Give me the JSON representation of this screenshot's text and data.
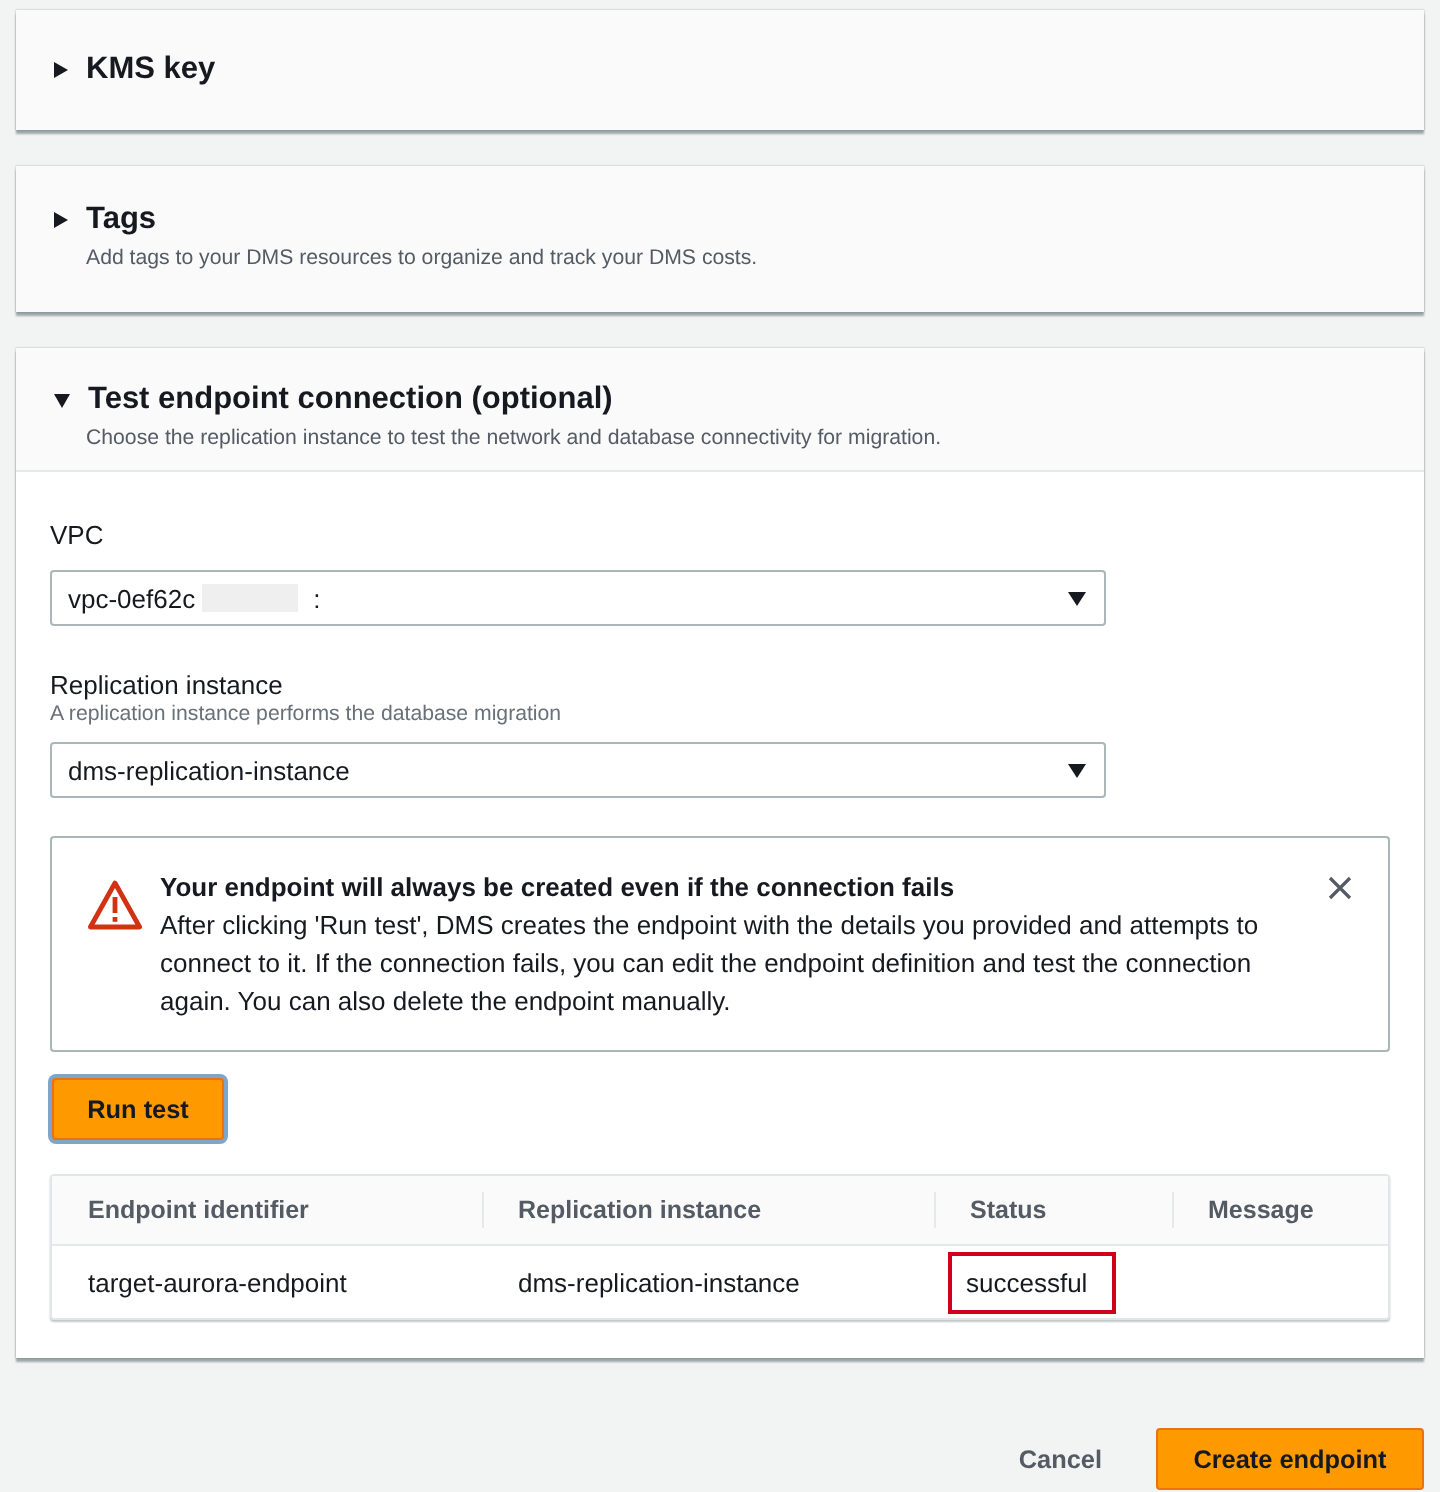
{
  "sections": [
    {
      "title": "KMS key",
      "expanded": false
    },
    {
      "title": "Tags",
      "description": "Add tags to your DMS resources to organize and track your DMS costs.",
      "expanded": false
    },
    {
      "title": "Test endpoint connection (optional)",
      "description": "Choose the replication instance to test the network and database connectivity for migration.",
      "expanded": true,
      "fields": [
        {
          "label": "VPC",
          "value": "vpc-0ef62c",
          "redacted": true,
          "value_suffix": ":"
        },
        {
          "label": "Replication instance",
          "hint": "A replication instance performs the database migration",
          "value": "dms-replication-instance"
        }
      ],
      "alert": {
        "kind": "warning",
        "title": "Your endpoint will always be created even if the connection fails",
        "text": "After clicking 'Run test', DMS creates the endpoint with the details you provided and attempts to connect to it. If the connection fails, you can edit the endpoint definition and test the connection again. You can also delete the endpoint manually.",
        "dismissible": true
      },
      "run_button": {
        "label": "Run test",
        "focused": true
      },
      "table": {
        "columns": [
          "Endpoint identifier",
          "Replication instance",
          "Status",
          "Message"
        ],
        "rows": [
          {
            "cells": [
              {
                "text": "target-aurora-endpoint",
                "highlighted": false
              },
              {
                "text": "dms-replication-instance",
                "highlighted": false
              },
              {
                "text": "successful",
                "highlighted": true
              }
            ]
          }
        ]
      }
    }
  ],
  "footer": {
    "buttons": [
      {
        "label": "Cancel",
        "kind": "link"
      },
      {
        "label": "Create endpoint",
        "kind": "primary"
      }
    ]
  }
}
